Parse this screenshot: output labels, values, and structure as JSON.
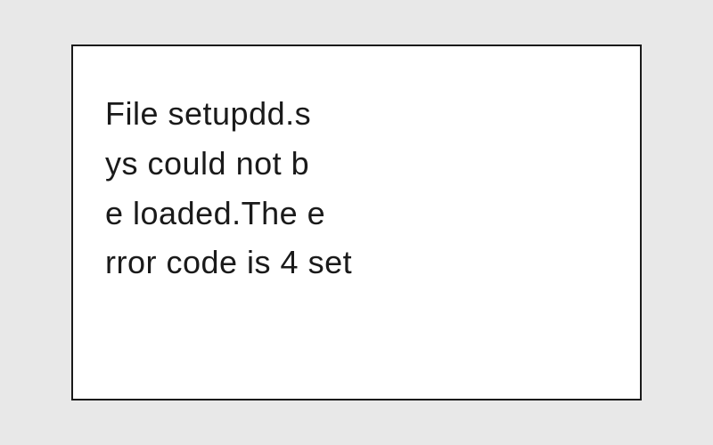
{
  "message": {
    "line1": "File setupdd.s",
    "line2": "ys could not b",
    "line3": "e loaded.The e",
    "line4": "rror code is 4 set"
  }
}
